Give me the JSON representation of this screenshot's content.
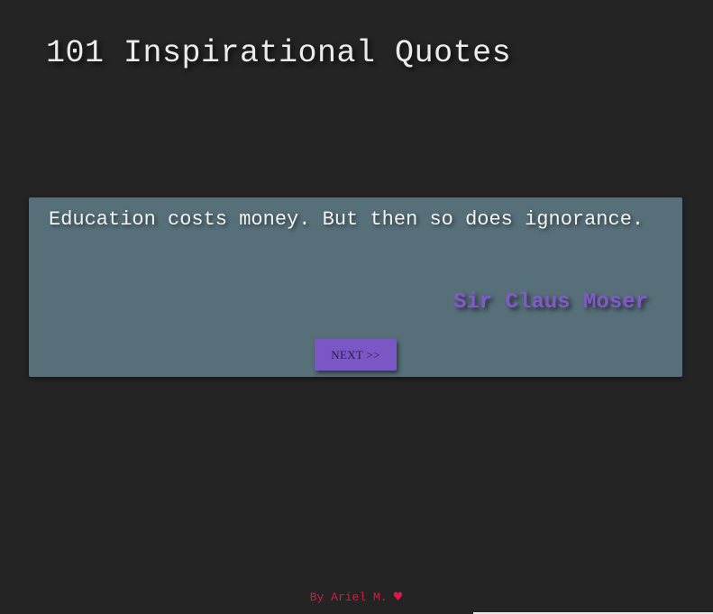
{
  "header": {
    "title": "101 Inspirational Quotes"
  },
  "quote": {
    "text": "Education costs money. But then so does ignorance.",
    "author": "Sir Claus Moser"
  },
  "controls": {
    "next_label": "NEXT >>"
  },
  "footer": {
    "credit": "By Ariel M.",
    "heart_icon": "heart-icon"
  },
  "colors": {
    "background": "#242424",
    "card": "#566f79",
    "accent": "#7b57c6",
    "author": "#8359c9",
    "footer": "#cf1f3d"
  }
}
